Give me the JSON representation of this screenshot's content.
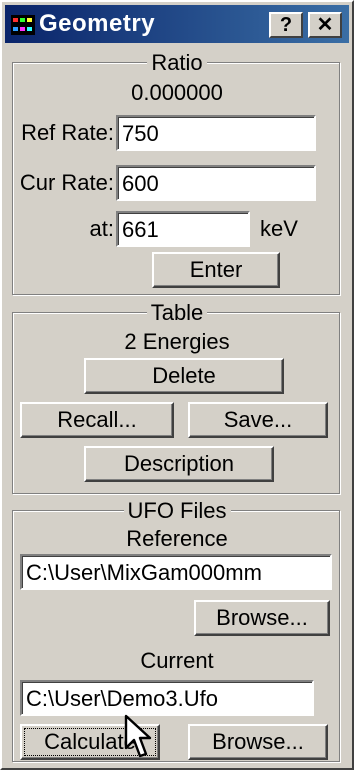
{
  "window": {
    "title": "Geometry",
    "help_label": "?",
    "close_label": "✕"
  },
  "ratio": {
    "title": "Ratio",
    "value": "0.000000",
    "ref_rate_label": "Ref Rate:",
    "ref_rate_value": "750",
    "cur_rate_label": "Cur Rate:",
    "cur_rate_value": "600",
    "at_label": "at:",
    "at_value": "661",
    "unit": "keV",
    "enter_label": "Enter"
  },
  "table": {
    "title": "Table",
    "count_text": "2  Energies",
    "delete_label": "Delete",
    "recall_label": "Recall...",
    "save_label": "Save...",
    "description_label": "Description"
  },
  "ufo": {
    "title": "UFO Files",
    "reference_label": "Reference",
    "reference_value": "C:\\User\\MixGam000mm",
    "browse_ref_label": "Browse...",
    "current_label": "Current",
    "current_value": "C:\\User\\Demo3.Ufo",
    "calculate_label": "Calculate",
    "browse_cur_label": "Browse..."
  },
  "icons": [
    "app-icon",
    "mouse-cursor-icon"
  ],
  "colors": {
    "titlebar": "#0a246a",
    "face": "#d4d0c8"
  }
}
